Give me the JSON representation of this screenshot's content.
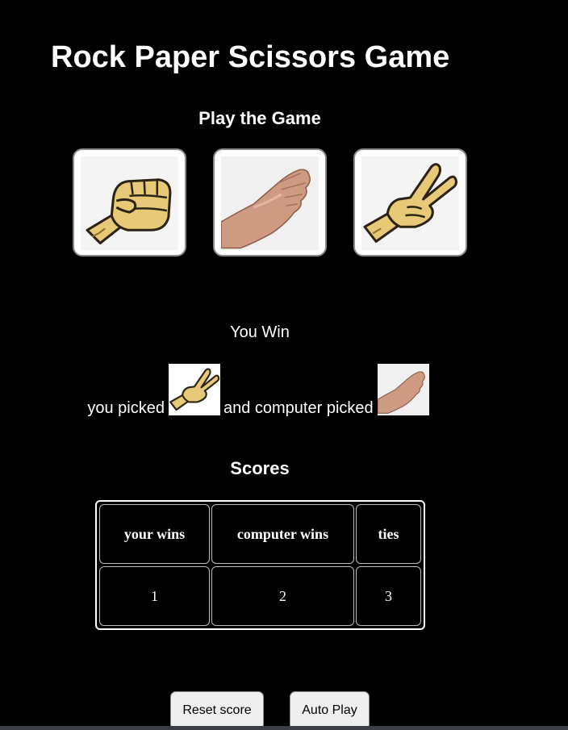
{
  "page": {
    "title": "Rock Paper Scissors Game",
    "subtitle": "Play the Game"
  },
  "moves": [
    {
      "name": "rock",
      "icon": "rock-fist-icon"
    },
    {
      "name": "paper",
      "icon": "paper-hand-icon"
    },
    {
      "name": "scissors",
      "icon": "scissors-hand-icon"
    }
  ],
  "result": {
    "text": "You Win",
    "you_picked_label": "you picked",
    "computer_picked_label": "and computer picked",
    "player_move_icon": "scissors-hand-icon",
    "computer_move_icon": "paper-hand-icon"
  },
  "scores": {
    "title": "Scores",
    "headers": [
      "your wins",
      "computer wins",
      "ties"
    ],
    "values": [
      "1",
      "2",
      "3"
    ]
  },
  "controls": {
    "reset_label": "Reset score",
    "auto_play_label": "Auto Play"
  },
  "colors": {
    "background": "#000000",
    "text": "#ffffff",
    "button_bg": "#efefef",
    "skin": "#e8c977"
  }
}
